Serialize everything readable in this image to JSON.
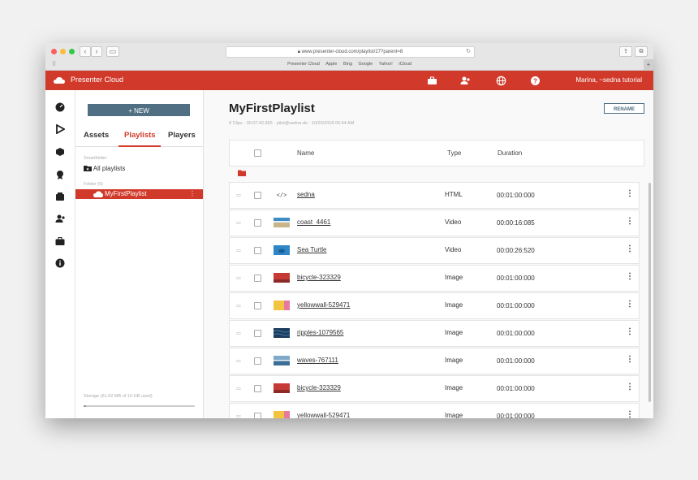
{
  "browser": {
    "url": "www.presenter-cloud.com/playlist/27?parent=8",
    "bookmarks": [
      "Presenter Cloud",
      "Apple",
      "Bing",
      "Google",
      "Yahoo!",
      "iCloud"
    ]
  },
  "header": {
    "brand": "Presenter Cloud",
    "user": "Marina, ~sedna tutorial",
    "color": "#d13a2b"
  },
  "panel": {
    "new_label": "+ NEW",
    "tabs": [
      {
        "label": "Assets"
      },
      {
        "label": "Playlists"
      },
      {
        "label": "Players"
      }
    ],
    "smartfolder_label": "Smartfolder",
    "all_playlists": "All playlists",
    "folder_label": "Folder (0)",
    "current_playlist": "MyFirstPlaylist",
    "storage": "Storage (61.62 MB of 10 GB used)"
  },
  "main": {
    "title": "MyFirstPlaylist",
    "meta": "9 Clips · 00:07:42.865 · pilot@sedna.de · 10/25/2018 05:44 AM",
    "rename_label": "RENAME",
    "columns": {
      "name": "Name",
      "type": "Type",
      "duration": "Duration"
    },
    "rows": [
      {
        "name": "sedna",
        "type": "HTML",
        "duration": "00:01:00:000",
        "thumb": "html-icon"
      },
      {
        "name": "coast_4461",
        "type": "Video",
        "duration": "00:00:16:085",
        "thumb": "coast"
      },
      {
        "name": "Sea Turtle",
        "type": "Video",
        "duration": "00:00:26:520",
        "thumb": "turtle"
      },
      {
        "name": "bicycle-323329",
        "type": "Image",
        "duration": "00:01:00:000",
        "thumb": "bicycle"
      },
      {
        "name": "yellowwall-529471",
        "type": "Image",
        "duration": "00:01:00:000",
        "thumb": "yellowwall"
      },
      {
        "name": "ripples-1079565",
        "type": "Image",
        "duration": "00:01:00:000",
        "thumb": "ripples"
      },
      {
        "name": "waves-767111",
        "type": "Image",
        "duration": "00:01:00:000",
        "thumb": "waves"
      },
      {
        "name": "bicycle-323329",
        "type": "Image",
        "duration": "00:01:00:000",
        "thumb": "bicycle"
      },
      {
        "name": "yellowwall-529471",
        "type": "Image",
        "duration": "00:01:00:000",
        "thumb": "yellowwall"
      }
    ]
  }
}
